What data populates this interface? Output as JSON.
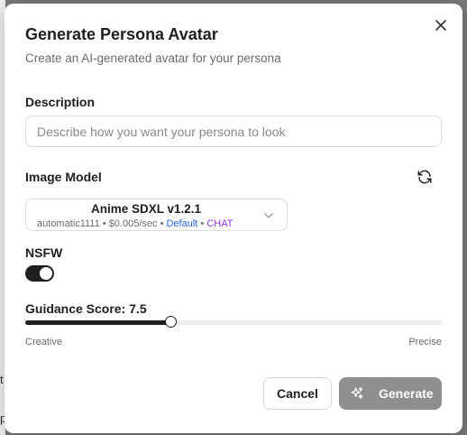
{
  "dialog": {
    "title": "Generate Persona Avatar",
    "subtitle": "Create an AI-generated avatar for your persona",
    "close_icon": "close-icon"
  },
  "description": {
    "label": "Description",
    "value": "",
    "placeholder": "Describe how you want your persona to look"
  },
  "image_model": {
    "label": "Image Model",
    "refresh_icon": "refresh-icon",
    "selected": {
      "name": "Anime SDXL v1.2.1",
      "provider": "automatic1111",
      "separator": " • ",
      "price": "$0.005/sec",
      "badge_default": "Default",
      "badge_chat": "CHAT"
    },
    "default_color": "#2563eb",
    "chat_color": "#9333ea"
  },
  "nsfw": {
    "label": "NSFW",
    "enabled": true
  },
  "guidance": {
    "label": "Guidance Score: 7.5",
    "value": 7.5,
    "fill_fraction": 0.35,
    "min_label": "Creative",
    "max_label": "Precise"
  },
  "actions": {
    "cancel_label": "Cancel",
    "generate_label": "Generate",
    "generate_icon": "sparkle-icon",
    "generate_color": "#8f8f8f"
  },
  "backdrop": {
    "fragment_1": "t",
    "fragment_2": "p"
  }
}
